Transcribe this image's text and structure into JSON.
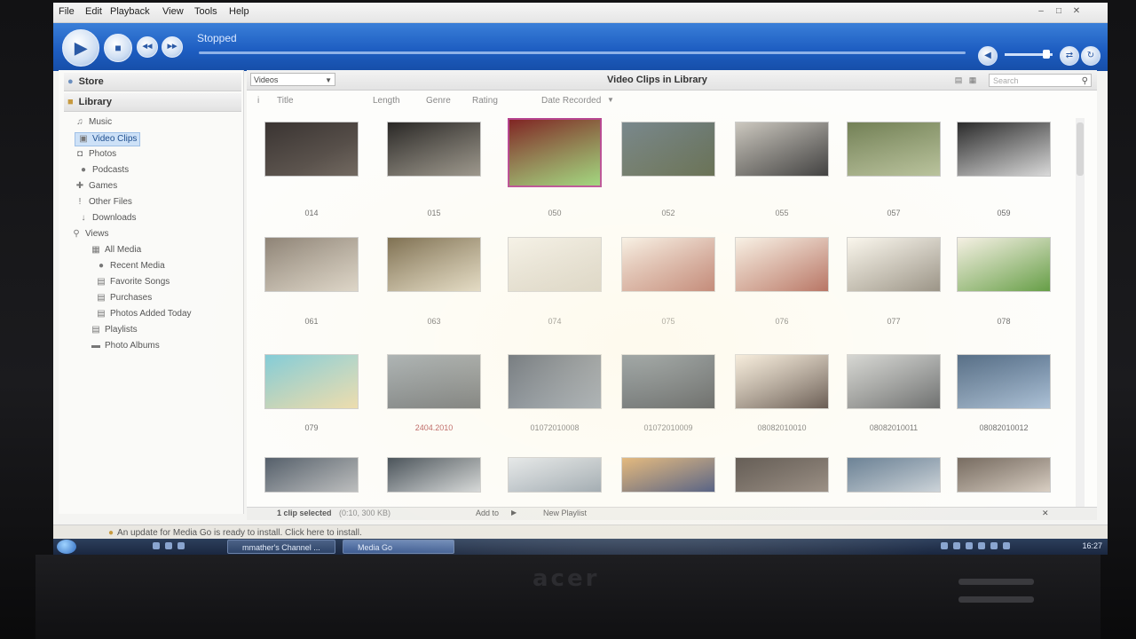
{
  "menubar": {
    "items": [
      "File",
      "Edit",
      "Playback",
      "View",
      "Tools",
      "Help"
    ]
  },
  "player": {
    "status": "Stopped",
    "buttons": {
      "play": "▶",
      "stop": "■",
      "prev": "◀◀",
      "next": "▶▶"
    }
  },
  "sidebar": {
    "store": "Store",
    "library": "Library",
    "items": [
      {
        "label": "Music",
        "icon": "music-note-icon",
        "glyph": "♫"
      },
      {
        "label": "Video Clips",
        "icon": "film-icon",
        "glyph": "▣"
      },
      {
        "label": "Photos",
        "icon": "photo-icon",
        "glyph": "◘"
      },
      {
        "label": "Podcasts",
        "icon": "podcast-icon",
        "glyph": "●"
      },
      {
        "label": "Games",
        "icon": "gamepad-icon",
        "glyph": "✚"
      },
      {
        "label": "Other Files",
        "icon": "file-icon",
        "glyph": "!"
      },
      {
        "label": "Downloads",
        "icon": "download-icon",
        "glyph": "↓"
      },
      {
        "label": "Views",
        "icon": "search-icon",
        "glyph": "⚲"
      },
      {
        "label": "All Media",
        "icon": "all-media-icon",
        "glyph": "▦"
      },
      {
        "label": "Recent Media",
        "icon": "recent-icon",
        "glyph": "●"
      },
      {
        "label": "Favorite Songs",
        "icon": "list-icon",
        "glyph": "▤"
      },
      {
        "label": "Purchases",
        "icon": "list-icon",
        "glyph": "▤"
      },
      {
        "label": "Photos Added Today",
        "icon": "list-icon",
        "glyph": "▤"
      },
      {
        "label": "Playlists",
        "icon": "playlist-icon",
        "glyph": "▤"
      },
      {
        "label": "Photo Albums",
        "icon": "album-icon",
        "glyph": "▬"
      }
    ]
  },
  "content": {
    "view_select": "Videos",
    "title": "Video Clips in Library",
    "search_placeholder": "Search",
    "columns": [
      "Title",
      "Length",
      "Genre",
      "Rating",
      "Date Recorded"
    ]
  },
  "clips": [
    {
      "label": "014",
      "colors": [
        "#3a3432",
        "#6b625a"
      ]
    },
    {
      "label": "015",
      "colors": [
        "#2a2826",
        "#8f8a80"
      ]
    },
    {
      "label": "050",
      "colors": [
        "#7a1a1a",
        "#8fcf6a"
      ]
    },
    {
      "label": "052",
      "colors": [
        "#6f7f86",
        "#4f5a3c"
      ]
    },
    {
      "label": "055",
      "colors": [
        "#c9c5bd",
        "#2b2b2d"
      ]
    },
    {
      "label": "057",
      "colors": [
        "#6f7d52",
        "#b7c19a"
      ]
    },
    {
      "label": "059",
      "colors": [
        "#2b2b2b",
        "#d9d9d9"
      ]
    },
    {
      "label": "061",
      "colors": [
        "#8a7f72",
        "#d7cfc2"
      ]
    },
    {
      "label": "063",
      "colors": [
        "#6a5a3a",
        "#d9d0b8"
      ]
    },
    {
      "label": "074",
      "colors": [
        "#f3f0e8",
        "#c9c3b5"
      ]
    },
    {
      "label": "075",
      "colors": [
        "#f6efe6",
        "#a0493a"
      ]
    },
    {
      "label": "076",
      "colors": [
        "#f6efe6",
        "#a0493a"
      ]
    },
    {
      "label": "077",
      "colors": [
        "#f9f6ef",
        "#8a8377"
      ]
    },
    {
      "label": "078",
      "colors": [
        "#f4efe3",
        "#5f9a3f"
      ]
    },
    {
      "label": "079",
      "colors": [
        "#79c8d6",
        "#ead8a4"
      ]
    },
    {
      "label": "2404.2010",
      "colors": [
        "#9aa3a8",
        "#5a5e60"
      ]
    },
    {
      "label": "01072010008",
      "colors": [
        "#2e3a4c",
        "#7d8a9a"
      ]
    },
    {
      "label": "01072010009",
      "colors": [
        "#3b4f63",
        "#1e232a"
      ]
    },
    {
      "label": "08082010010",
      "colors": [
        "#efe3d6",
        "#3a2b26"
      ]
    },
    {
      "label": "08082010011",
      "colors": [
        "#c8cbcd",
        "#56595c"
      ]
    },
    {
      "label": "08082010012",
      "colors": [
        "#3d5978",
        "#a9bfd6"
      ]
    },
    {
      "label": "",
      "colors": [
        "#4f5a66",
        "#b7b9bb"
      ]
    },
    {
      "label": "",
      "colors": [
        "#2f3a45",
        "#cfd3d6"
      ]
    },
    {
      "label": "",
      "colors": [
        "#dfe4ea",
        "#8d9aa6"
      ]
    },
    {
      "label": "",
      "colors": [
        "#d9a25a",
        "#2f3f6f"
      ]
    },
    {
      "label": "",
      "colors": [
        "#352d2a",
        "#8b7f76"
      ]
    },
    {
      "label": "",
      "colors": [
        "#4e6a86",
        "#c9d1d8"
      ]
    },
    {
      "label": "",
      "colors": [
        "#6b5f55",
        "#d9cfc3"
      ]
    }
  ],
  "status": {
    "selection": "1 clip selected",
    "selection_detail": "(0:10, 300 KB)",
    "add_to": "Add to",
    "new_playlist": "New Playlist"
  },
  "update_bar": {
    "message": "An update for Media Go is ready to install. Click here to install."
  },
  "taskbar": {
    "task_1": "mmather's Channel ...",
    "task_2": "Media Go",
    "clock": "16:27"
  },
  "bezel": {
    "brand": "acer"
  }
}
